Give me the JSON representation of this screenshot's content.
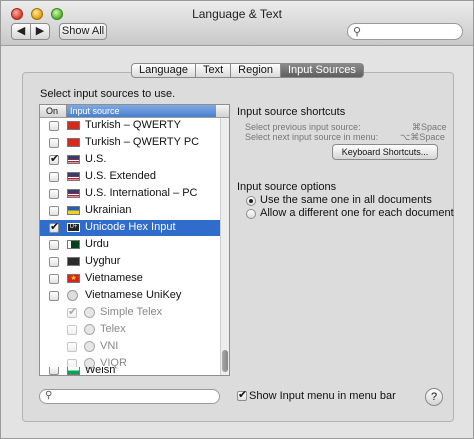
{
  "window": {
    "title": "Language & Text"
  },
  "toolbar": {
    "back": "◀",
    "forward": "▶",
    "show_all": "Show All"
  },
  "tabs": [
    {
      "label": "Language"
    },
    {
      "label": "Text"
    },
    {
      "label": "Region"
    },
    {
      "label": "Input Sources"
    }
  ],
  "left": {
    "select_label": "Select input sources to use.",
    "header_on": "On",
    "header_source": "Input source",
    "rows": [
      {
        "label": "Turkish – QWERTY",
        "checked": false
      },
      {
        "label": "Turkish – QWERTY PC",
        "checked": false
      },
      {
        "label": "U.S.",
        "checked": true
      },
      {
        "label": "U.S. Extended",
        "checked": false
      },
      {
        "label": "U.S. International – PC",
        "checked": false
      },
      {
        "label": "Ukrainian",
        "checked": false
      },
      {
        "label": "Unicode Hex Input",
        "checked": true
      },
      {
        "label": "Urdu",
        "checked": false
      },
      {
        "label": "Uyghur",
        "checked": false
      },
      {
        "label": "Vietnamese",
        "checked": false
      },
      {
        "label": "Vietnamese UniKey",
        "checked": false
      },
      {
        "label": "Simple Telex",
        "checked": true
      },
      {
        "label": "Telex",
        "checked": false
      },
      {
        "label": "VNI",
        "checked": false
      },
      {
        "label": "VIQR",
        "checked": false
      },
      {
        "label": "Welsh",
        "checked": false
      }
    ],
    "show_menu_label": "Show Input menu in menu bar"
  },
  "right": {
    "shortcuts_title": "Input source shortcuts",
    "prev_label": "Select previous input source:",
    "prev_key": "⌘Space",
    "next_label": "Select next input source in menu:",
    "next_key": "⌥⌘Space",
    "kbd_button": "Keyboard Shortcuts...",
    "options_title": "Input source options",
    "option_same": "Use the same one in all documents",
    "option_different": "Allow a different one for each document"
  },
  "help": "?",
  "colors": {
    "selection": "#2f6ccc",
    "active_tab": "#6e6e6e"
  }
}
